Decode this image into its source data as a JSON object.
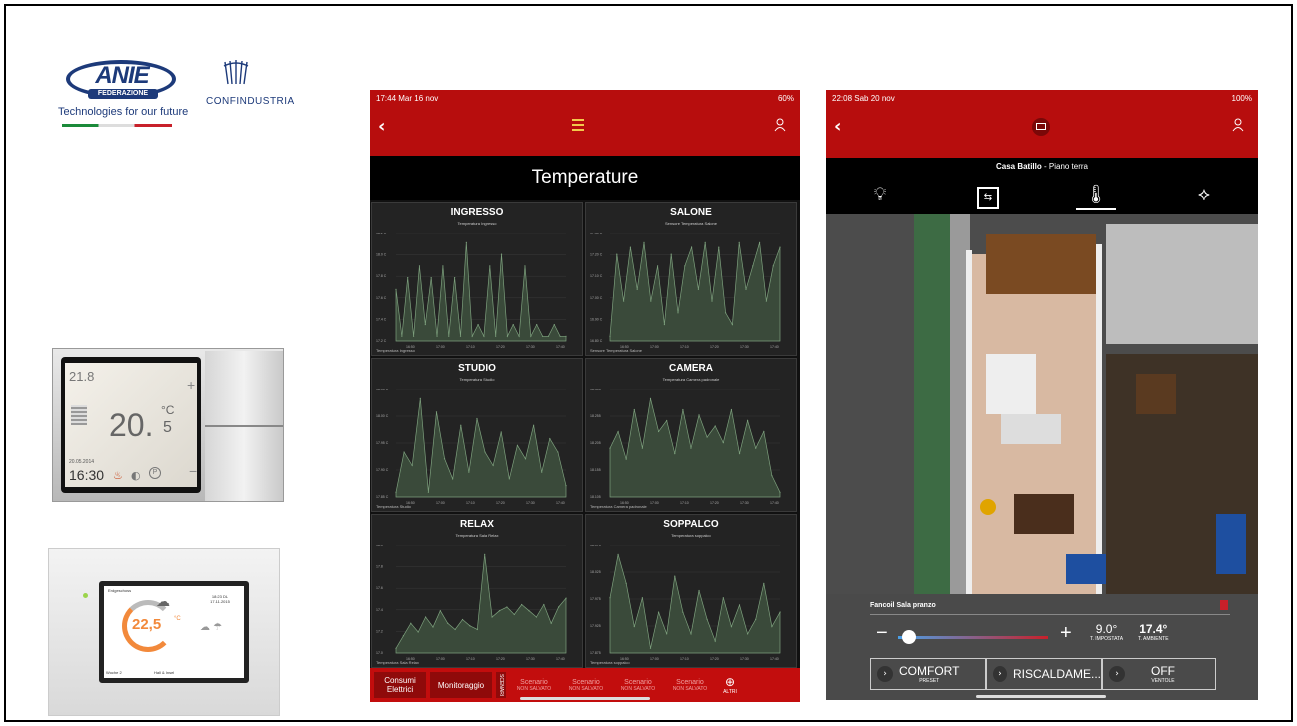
{
  "logos": {
    "anie": "ANIE",
    "anie_fed": "FEDERAZIONE",
    "anie_tagline": "Technologies for our future",
    "confindustria": "CONFINDUSTRIA"
  },
  "thermostat1": {
    "setpoint": "20.",
    "setpoint_dec": "5",
    "unit": "°C",
    "small_temp": "21.8",
    "date": "20.05.2014",
    "time": "16:30"
  },
  "thermostat2": {
    "temp": "22,5",
    "unit": "°C",
    "label_top": "Erdgeschoss",
    "date": "18:23 DL 17.11.2015",
    "bottom_left": "Woche 2",
    "bottom_mid": "Hall & Insel"
  },
  "tablet1": {
    "status_time": "17:44  Mar 16 nov",
    "status_battery": "60%",
    "title": "Temperature",
    "panels": [
      {
        "title": "INGRESSO",
        "sub": "Temperatura Ingresso",
        "legend": "Temperatura Ingresso"
      },
      {
        "title": "SALONE",
        "sub": "Sensore Temperatura Salone",
        "legend": "Sensore Temperatura Salone"
      },
      {
        "title": "STUDIO",
        "sub": "Temperatura Studio",
        "legend": "Temperatura Studio"
      },
      {
        "title": "CAMERA",
        "sub": "Temperatura Camera padronale",
        "legend": "Temperatura Camera padronale"
      },
      {
        "title": "RELAX",
        "sub": "Temperatura Sala Relax",
        "legend": "Temperatura Sala Relax"
      },
      {
        "title": "SOPPALCO",
        "sub": "Temperatura soppalco",
        "legend": "Temperatura soppalco"
      }
    ],
    "bottom": {
      "consumi": "Consumi Elettrici",
      "monitoraggio": "Monitoraggio",
      "scenari": "SCENARI",
      "scenario_label": "Scenario",
      "scenario_sub": "NON SALVATO",
      "altri": "ALTRI"
    }
  },
  "tablet2": {
    "status_time": "22:08  Sab 20 nov",
    "status_battery": "100%",
    "house": "Casa Batillo",
    "floor": " - Piano terra",
    "fancoil": "Fancoil Sala pranzo",
    "set_temp": "9.0°",
    "set_label": "T. IMPOSTATA",
    "amb_temp": "17.4°",
    "amb_label": "T. AMBIENTE",
    "preset": "COMFORT",
    "preset_label": "PRESET",
    "mode": "RISCALDAME...",
    "fan": "OFF",
    "fan_label": "VENTOLE",
    "minus": "−",
    "plus": "+"
  },
  "chart_data": [
    {
      "type": "area",
      "title": "INGRESSO",
      "x": [
        "16:50",
        "17:00",
        "17:10",
        "17:20",
        "17:30",
        "17:40"
      ],
      "y_ticks": [
        "17.2 C",
        "17.4 C",
        "17.6 C",
        "17.8 C",
        "18.0 C",
        "18.2 C"
      ],
      "values": [
        17.7,
        17.3,
        17.8,
        17.3,
        17.9,
        17.4,
        17.8,
        17.3,
        17.9,
        17.3,
        17.8,
        17.3,
        18.1,
        17.3,
        17.4,
        17.3,
        17.9,
        17.3,
        18.0,
        17.3,
        17.4,
        17.3,
        17.9,
        17.3,
        17.4,
        17.3,
        17.3,
        17.4,
        17.3,
        17.3
      ]
    },
    {
      "type": "area",
      "title": "SALONE",
      "x": [
        "16:50",
        "17:00",
        "17:10",
        "17:20",
        "17:30",
        "17:40"
      ],
      "y_ticks": [
        "16.80 C",
        "16.90 C",
        "17.00 C",
        "17.10 C",
        "17.20 C",
        "17.30 C"
      ],
      "values": [
        16.9,
        17.25,
        17.05,
        17.28,
        17.1,
        17.3,
        17.05,
        17.2,
        16.95,
        17.25,
        17.0,
        17.2,
        17.28,
        17.1,
        17.3,
        17.05,
        17.28,
        17.0,
        16.95,
        17.3,
        17.1,
        17.2,
        17.3,
        17.05,
        17.2,
        17.28
      ]
    },
    {
      "type": "area",
      "title": "STUDIO",
      "x": [
        "16:50",
        "17:00",
        "17:10",
        "17:20",
        "17:30",
        "17:40"
      ],
      "y_ticks": [
        "17.85 C",
        "17.90 C",
        "17.95 C",
        "18.00 C",
        "18.05 C"
      ],
      "values": [
        17.9,
        17.96,
        17.94,
        18.04,
        17.9,
        18.02,
        17.95,
        17.92,
        18.0,
        17.93,
        18.01,
        17.96,
        17.94,
        17.99,
        17.92,
        17.97,
        17.95,
        18.0,
        17.93,
        17.98,
        17.96,
        17.91
      ]
    },
    {
      "type": "area",
      "title": "CAMERA",
      "x": [
        "16:50",
        "17:00",
        "17:10",
        "17:20",
        "17:30",
        "17:40"
      ],
      "y_ticks": [
        "18.105",
        "18.155",
        "18.205",
        "18.255",
        "18.305"
      ],
      "values": [
        18.2,
        18.23,
        18.18,
        18.27,
        18.2,
        18.29,
        18.23,
        18.25,
        18.19,
        18.27,
        18.2,
        18.26,
        18.22,
        18.24,
        18.21,
        18.27,
        18.19,
        18.25,
        18.2,
        18.23,
        18.15,
        18.12
      ]
    },
    {
      "type": "area",
      "title": "RELAX",
      "x": [
        "16:50",
        "17:00",
        "17:10",
        "17:20",
        "17:30",
        "17:40"
      ],
      "y_ticks": [
        "17.0",
        "17.2",
        "17.4",
        "17.6",
        "17.8",
        "18.0"
      ],
      "values": [
        17.15,
        17.25,
        17.35,
        17.28,
        17.4,
        17.32,
        17.45,
        17.35,
        17.3,
        17.38,
        17.33,
        17.3,
        17.9,
        17.4,
        17.45,
        17.48,
        17.42,
        17.5,
        17.45,
        17.4,
        17.5,
        17.35,
        17.48,
        17.55
      ]
    },
    {
      "type": "area",
      "title": "SOPPALCO",
      "x": [
        "16:50",
        "17:00",
        "17:10",
        "17:20",
        "17:30",
        "17:40"
      ],
      "y_ticks": [
        "17.875",
        "17.925",
        "17.975",
        "18.025",
        "18.075"
      ],
      "values": [
        18.0,
        18.06,
        18.02,
        17.96,
        18.0,
        17.93,
        17.98,
        17.95,
        18.03,
        17.98,
        17.95,
        18.01,
        17.97,
        17.94,
        18.0,
        17.96,
        17.99,
        17.95,
        17.97,
        18.02,
        17.96,
        17.98
      ]
    }
  ],
  "colors": {
    "app_red": "#b70d0d",
    "chart_fill": "#3a4a3a",
    "chart_line": "#7da07d"
  }
}
